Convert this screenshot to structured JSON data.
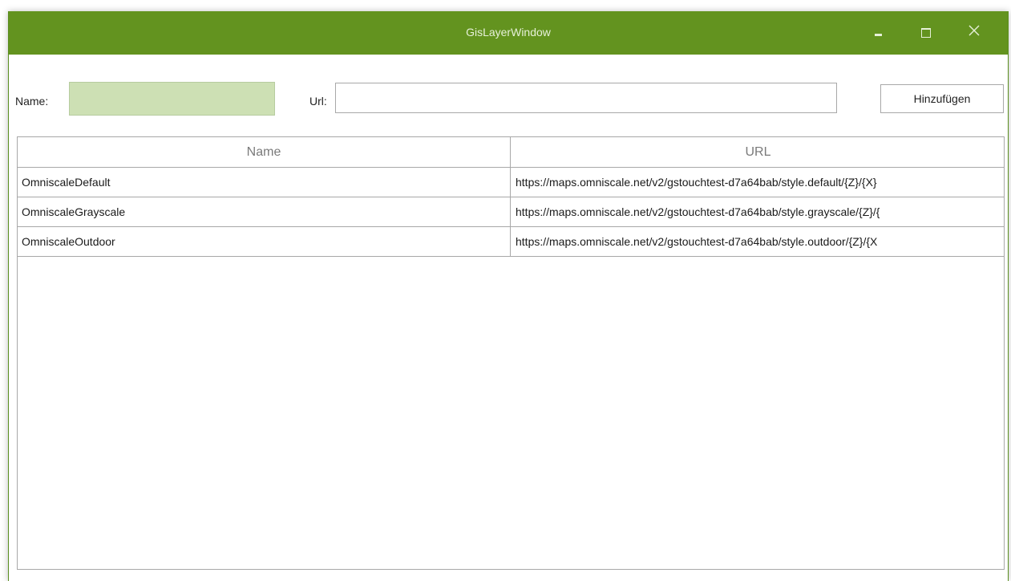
{
  "window": {
    "title": "GisLayerWindow",
    "accent_color": "#63931f",
    "controls": {
      "minimize_icon": "minimize-icon",
      "maximize_icon": "maximize-icon",
      "close_icon": "close-icon"
    }
  },
  "form": {
    "name_label": "Name:",
    "name_value": "",
    "url_label": "Url:",
    "url_value": "",
    "add_button_label": "Hinzufügen"
  },
  "grid": {
    "columns": [
      "Name",
      "URL"
    ],
    "rows": [
      {
        "name": "OmniscaleDefault",
        "url": "https://maps.omniscale.net/v2/gstouchtest-d7a64bab/style.default/{Z}/{X}"
      },
      {
        "name": "OmniscaleGrayscale",
        "url": "https://maps.omniscale.net/v2/gstouchtest-d7a64bab/style.grayscale/{Z}/{"
      },
      {
        "name": "OmniscaleOutdoor",
        "url": "https://maps.omniscale.net/v2/gstouchtest-d7a64bab/style.outdoor/{Z}/{X"
      }
    ]
  }
}
